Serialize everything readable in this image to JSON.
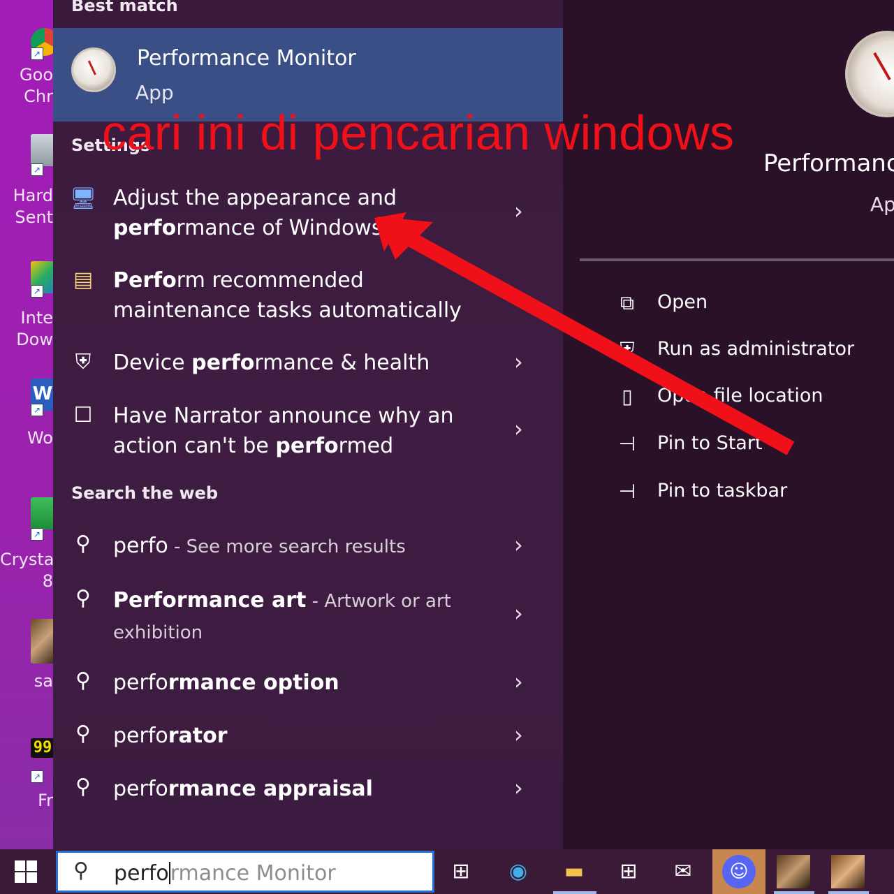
{
  "desktop": {
    "icons": [
      {
        "label": "Goo\nChr",
        "icon": "chrome-icon"
      },
      {
        "label": "Hard\nSent",
        "icon": "hard-disk-sentinel-icon"
      },
      {
        "label": "Inte\nDow",
        "icon": "internet-download-manager-icon"
      },
      {
        "label": "Wo",
        "icon": "word-icon"
      },
      {
        "label": "Crysta\n8",
        "icon": "crystaldisk-icon"
      },
      {
        "label": "sa",
        "icon": "game-icon"
      },
      {
        "label": "Fr",
        "icon": "fraps-icon"
      }
    ],
    "shortcut_badge": "99"
  },
  "search": {
    "best_match_title": "Best match",
    "best_match": {
      "name": "Performance Monitor",
      "kind": "App"
    },
    "settings_title": "Settings",
    "settings_items": [
      {
        "pre": "Adjust the appearance and ",
        "bold": "perfo",
        "post": "rmance of Windows",
        "icon": "computer-icon"
      },
      {
        "pre": "",
        "bold": "Perfo",
        "post": "rm recommended maintenance tasks automatically",
        "icon": "maintenance-icon"
      },
      {
        "pre": "Device ",
        "bold": "perfo",
        "post": "rmance & health",
        "icon": "shield-icon"
      },
      {
        "pre": "Have Narrator announce why an action can't be ",
        "bold": "perfo",
        "post": "rmed",
        "icon": "narrator-icon"
      }
    ],
    "web_title": "Search the web",
    "web_items": [
      {
        "bold": "perfo",
        "rest": "",
        "suffix": " - See more search results"
      },
      {
        "bold": "Performance art",
        "rest": "",
        "suffix": " - Artwork or art exhibition"
      },
      {
        "bold": "",
        "rest": "perfo",
        "rest2": "rmance option"
      },
      {
        "bold": "",
        "rest": "perfo",
        "rest2": "rator"
      },
      {
        "bold": "",
        "rest": "perfo",
        "rest2": "rmance appraisal"
      }
    ]
  },
  "detail": {
    "name": "Performanc",
    "kind": "Ap",
    "actions": [
      {
        "label": "Open",
        "icon": "open-icon"
      },
      {
        "label": "Run as administrator",
        "icon": "admin-shield-icon"
      },
      {
        "label": "Open file location",
        "icon": "folder-icon"
      },
      {
        "label": "Pin to Start",
        "icon": "pin-icon"
      },
      {
        "label": "Pin to taskbar",
        "icon": "pin-icon"
      }
    ]
  },
  "taskbar": {
    "search_typed": "perfo",
    "search_ghost": "rmance Monitor"
  },
  "annotation": {
    "text": "cari ini di pencarian windows",
    "color": "#f0101a"
  }
}
